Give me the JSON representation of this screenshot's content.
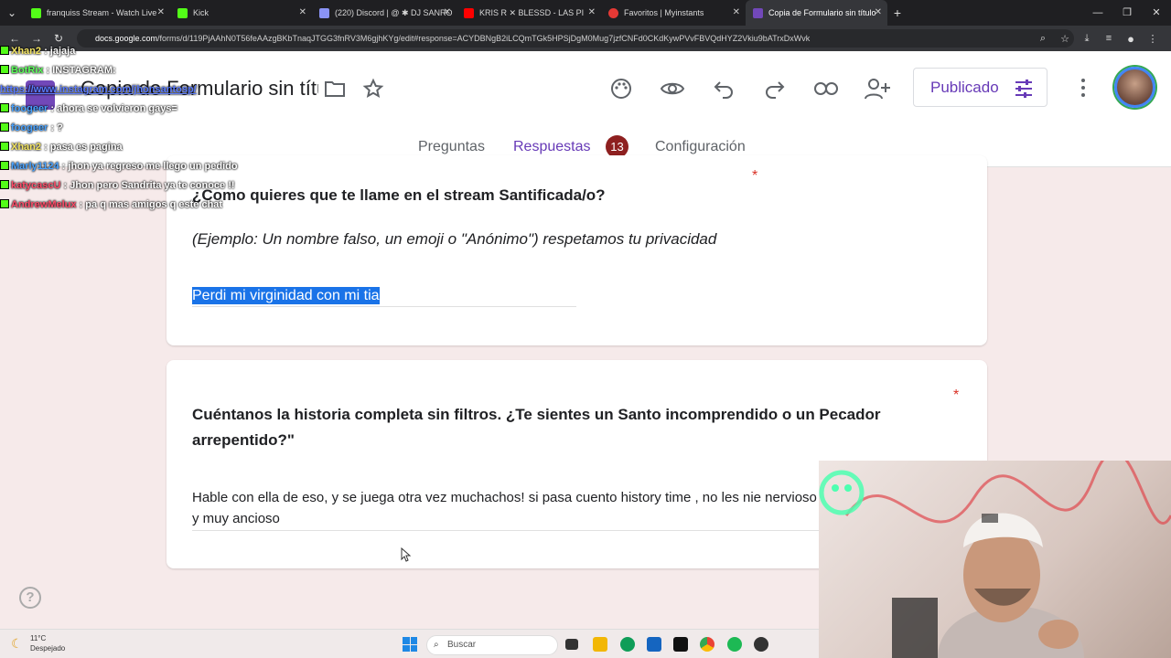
{
  "browser": {
    "tabs": [
      {
        "label": "franquiss Stream - Watch Live"
      },
      {
        "label": "Kick"
      },
      {
        "label": "(220) Discord | @ ✱ DJ SANRO"
      },
      {
        "label": "KRIS R ✕ BLESSD - LAS PI"
      },
      {
        "label": "Favoritos | Myinstants"
      },
      {
        "label": "Copia de Formulario sin título"
      }
    ],
    "url_host": "docs.google.com",
    "url_path": "/forms/d/119PjAAhN0T56feAAzgBKbTnaqJTGG3fnRV3M6gjhKYg/edit#response=ACYDBNgB2iLCQmTGk5HPSjDgM0Mug7jzfCNFd0CKdKywPVvFBVQdHYZ2Vkiu9bATrxDxWvk"
  },
  "header": {
    "form_title": "Copia de Formulario sin títu",
    "publish_label": "Publicado",
    "tabs": [
      "Preguntas",
      "Respuestas",
      "Configuración"
    ],
    "response_count": "13"
  },
  "cards": [
    {
      "question": "¿Como quieres que te llame en el stream Santificada/o?",
      "hint": "(Ejemplo: Un nombre falso, un emoji o \"Anónimo\") respetamos tu privacidad",
      "answer": "Perdi mi virginidad con mi tia",
      "required_mark": "*"
    },
    {
      "question": "Cuéntanos la historia completa sin filtros. ¿Te sientes un Santo incomprendido o un Pecador arrepentido?\"",
      "answer": "Hable con ella de eso, y se juega otra vez muchachos! si pasa cuento history time , no les nie nervioso y muy ancioso",
      "required_mark": "*"
    }
  ],
  "chat_overlay": {
    "messages": [
      {
        "user": "Xhan2",
        "text": ": jajaja",
        "color": "#f5e663"
      },
      {
        "user": "BotRix",
        "text": ": INSTAGRAM:",
        "color": "#5cff5c"
      },
      {
        "user": "",
        "text": "https://www.instagram.com/jhonsantosp/",
        "color": "#5b7cff"
      },
      {
        "user": "foogeer",
        "text": ": ahora se volvieron gays=",
        "color": "#4aa3ff"
      },
      {
        "user": "foogeer",
        "text": ": ?",
        "color": "#4aa3ff"
      },
      {
        "user": "Xhan2",
        "text": ": pasa es pagina",
        "color": "#f5e663"
      },
      {
        "user": "Marly1124",
        "text": ": jhon ya regreso me llego un pedido",
        "color": "#4aa3ff"
      },
      {
        "user": "katycascU",
        "text": ": Jhon pero Sandrita ya te conoce !!",
        "color": "#ff4d6a"
      },
      {
        "user": "AndrewMelux",
        "text": ": pa q mas amigos q este chat",
        "color": "#ff4d6a"
      }
    ]
  },
  "taskbar": {
    "weather_temp": "11°C",
    "weather_desc": "Despejado",
    "search_placeholder": "Buscar"
  },
  "colors": {
    "accent": "#673ab7",
    "selection": "#1a73e8",
    "required": "#d93025",
    "badge": "#8e2020"
  }
}
